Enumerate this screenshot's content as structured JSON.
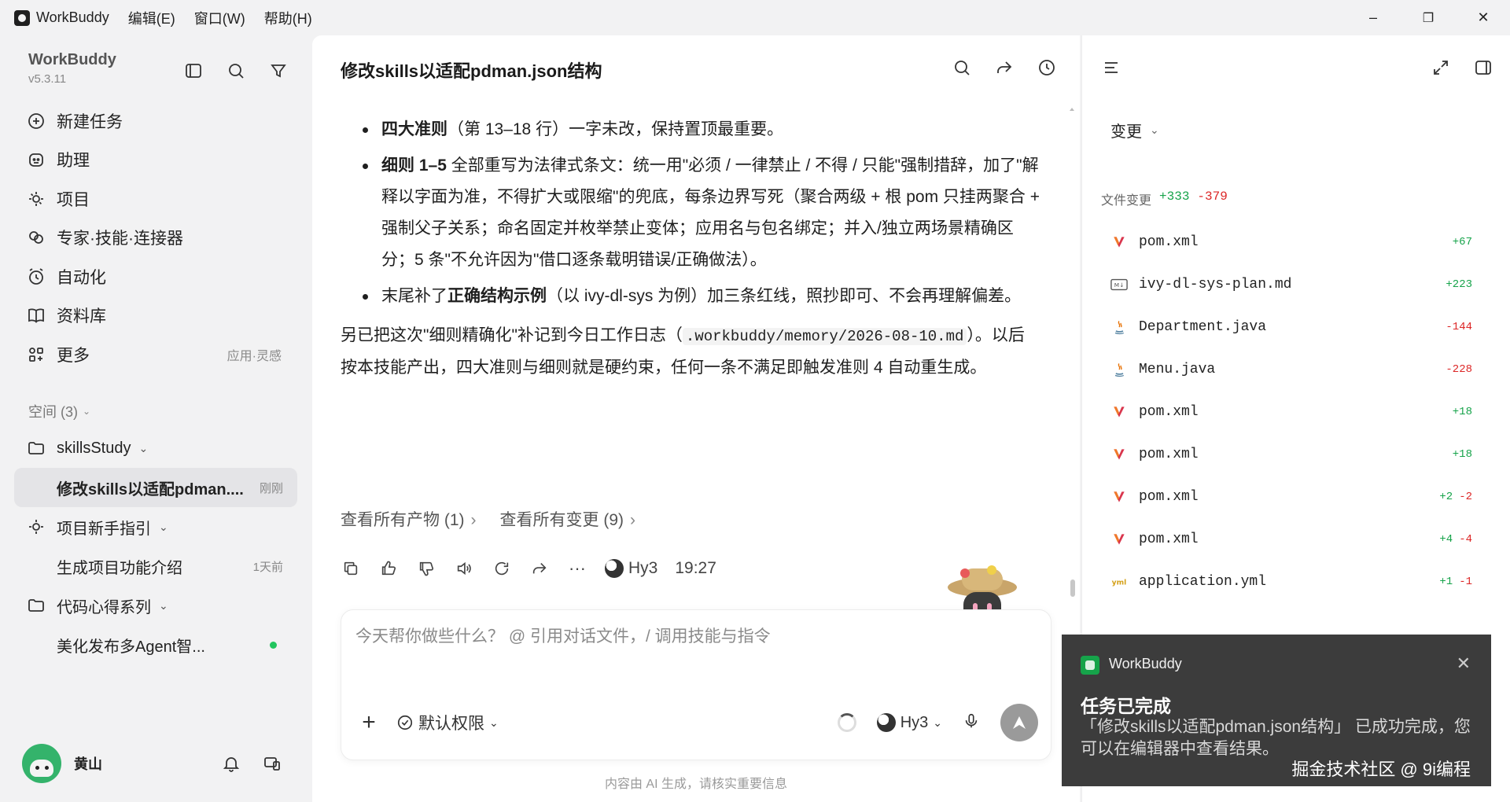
{
  "titlebar": {
    "app_name": "WorkBuddy",
    "menus": [
      "编辑(E)",
      "窗口(W)",
      "帮助(H)"
    ],
    "minimize": "–",
    "maximize": "❐",
    "close": "✕"
  },
  "sidebar": {
    "brand_name": "WorkBuddy",
    "version": "v5.3.11",
    "nav": [
      {
        "label": "新建任务",
        "icon": "plus-circle-icon"
      },
      {
        "label": "助理",
        "icon": "assistant-icon"
      },
      {
        "label": "项目",
        "icon": "project-icon"
      },
      {
        "label": "专家·技能·连接器",
        "icon": "expert-icon"
      },
      {
        "label": "自动化",
        "icon": "alarm-icon"
      },
      {
        "label": "资料库",
        "icon": "book-icon"
      },
      {
        "label": "更多",
        "icon": "grid-icon",
        "extra": "应用·灵感"
      }
    ],
    "space_label": "空间 (3)",
    "groups": [
      {
        "name": "skillsStudy",
        "items": [
          {
            "label": "修改skills以适配pdman....",
            "time": "刚刚",
            "active": true
          }
        ]
      },
      {
        "name": "项目新手指引",
        "items": [
          {
            "label": "生成项目功能介绍",
            "time": "1天前"
          }
        ]
      },
      {
        "name": "代码心得系列",
        "items": [
          {
            "label": "美化发布多Agent智...",
            "dot": true
          }
        ]
      }
    ],
    "user_name": "黄山"
  },
  "chat": {
    "title": "修改skills以适配pdman.json结构",
    "bullets": [
      {
        "bold": "四大准则",
        "rest": "（第 13–18 行）一字未改，保持置顶最重要。"
      },
      {
        "bold": "细则 1–5",
        "rest": " 全部重写为法律式条文：统一用\"必须 / 一律禁止 / 不得 / 只能\"强制措辞，加了\"解释以字面为准，不得扩大或限缩\"的兜底，每条边界写死（聚合两级 + 根 pom 只挂两聚合 + 强制父子关系；命名固定并枚举禁止变体；应用名与包名绑定；并入/独立两场景精确区分；5 条\"不允许因为\"借口逐条载明错误/正确做法）。"
      },
      {
        "pre": "末尾补了",
        "bold": "正确结构示例",
        "rest": "（以 ivy-dl-sys 为例）加三条红线，照抄即可、不会再理解偏差。"
      }
    ],
    "para_pre": "另已把这次\"细则精确化\"补记到今日工作日志（",
    "para_code": ".workbuddy/memory/2026-08-10.md",
    "para_post": "）。以后按本技能产出，四大准则与细则就是硬约束，任何一条不满足即触发准则 4 自动重生成。",
    "link_artifacts": "查看所有产物 (1)",
    "link_changes": "查看所有变更 (9)",
    "model": "Hy3",
    "time": "19:27",
    "composer_placeholder": "今天帮你做些什么？ @ 引用对话文件，/ 调用技能与指令",
    "permission": "默认权限",
    "composer_model": "Hy3",
    "footer": "内容由 AI 生成，请核实重要信息"
  },
  "right_panel": {
    "dropdown": "变更",
    "file_changes_label": "文件变更",
    "total_add": "+333",
    "total_del": "-379",
    "files": [
      {
        "name": "pom.xml",
        "add": "+67",
        "del": "",
        "icon": "maven-icon"
      },
      {
        "name": "ivy-dl-sys-plan.md",
        "add": "+223",
        "del": "",
        "icon": "markdown-icon"
      },
      {
        "name": "Department.java",
        "add": "",
        "del": "-144",
        "icon": "java-icon"
      },
      {
        "name": "Menu.java",
        "add": "",
        "del": "-228",
        "icon": "java-icon"
      },
      {
        "name": "pom.xml",
        "add": "+18",
        "del": "",
        "icon": "maven-icon"
      },
      {
        "name": "pom.xml",
        "add": "+18",
        "del": "",
        "icon": "maven-icon"
      },
      {
        "name": "pom.xml",
        "add": "+2",
        "del": "-2",
        "icon": "maven-icon"
      },
      {
        "name": "pom.xml",
        "add": "+4",
        "del": "-4",
        "icon": "maven-icon"
      },
      {
        "name": "application.yml",
        "add": "+1",
        "del": "-1",
        "icon": "yaml-icon"
      }
    ]
  },
  "toast": {
    "app": "WorkBuddy",
    "title": "任务已完成",
    "body": "「修改skills以适配pdman.json结构」 已成功完成，您可以在编辑器中查看结果。",
    "watermark": "掘金技术社区 @ 9i编程"
  },
  "colors": {
    "add": "#16a34a",
    "del": "#dc2626",
    "active_bg": "#e4e4e7",
    "toast_bg": "#3c3c3c"
  }
}
